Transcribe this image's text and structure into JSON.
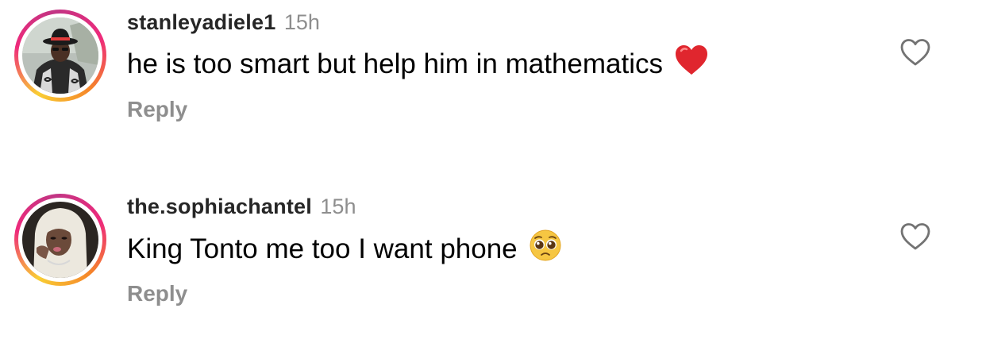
{
  "comments": [
    {
      "username": "stanleyadiele1",
      "time": "15h",
      "text": "he is too smart but help him in mathematics",
      "emoji": "red-heart",
      "reply_label": "Reply"
    },
    {
      "username": "the.sophiachantel",
      "time": "15h",
      "text": "King Tonto me too I want phone",
      "emoji": "pleading-face",
      "reply_label": "Reply"
    }
  ],
  "icons": {
    "like": "heart-outline-icon"
  },
  "colors": {
    "username": "#262626",
    "meta_gray": "#8e8e8e",
    "ring_start": "#f9ce34",
    "ring_mid": "#ee2a7b",
    "ring_end": "#c13584"
  }
}
